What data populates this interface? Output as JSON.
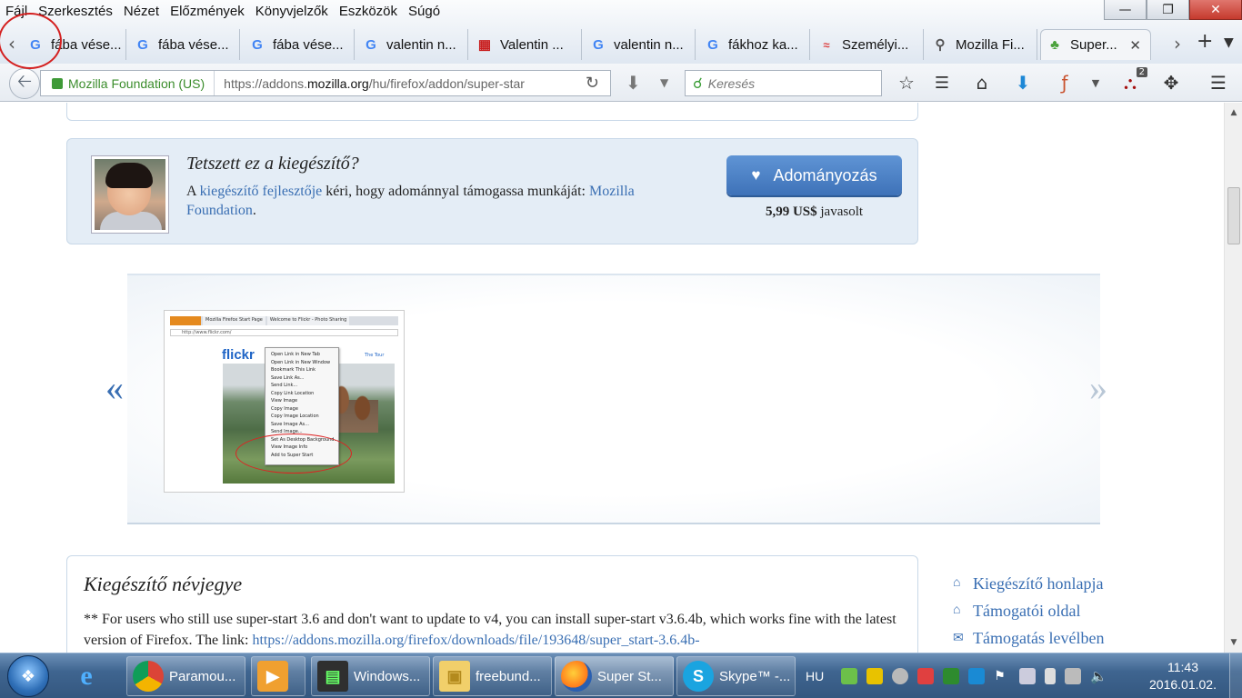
{
  "menubar": [
    "Fájl",
    "Szerkesztés",
    "Nézet",
    "Előzmények",
    "Könyvjelzők",
    "Eszközök",
    "Súgó"
  ],
  "tabs": [
    {
      "label": "fába vése...",
      "icon": "google-icon"
    },
    {
      "label": "fába vése...",
      "icon": "google-icon"
    },
    {
      "label": "fába vése...",
      "icon": "google-icon"
    },
    {
      "label": "valentin n...",
      "icon": "google-icon"
    },
    {
      "label": "Valentin ...",
      "icon": "gift-icon"
    },
    {
      "label": "valentin n...",
      "icon": "google-icon"
    },
    {
      "label": "fákhoz ka...",
      "icon": "google-icon"
    },
    {
      "label": "Személyi...",
      "icon": "chart-icon"
    },
    {
      "label": "Mozilla Fi...",
      "icon": "mozilla-icon"
    },
    {
      "label": "Super...",
      "icon": "puzzle-icon",
      "active": true
    }
  ],
  "nav": {
    "identity": "Mozilla Foundation (US)",
    "url_prefix": "https://addons.",
    "url_domain": "mozilla.org",
    "url_suffix": "/hu/firefox/addon/super-star",
    "search_placeholder": "Keresés",
    "badge_count": "2"
  },
  "donate": {
    "question": "Tetszett ez a kiegészítő?",
    "text_a": "A ",
    "dev_link": "kiegészítő fejlesztője",
    "text_b": " kéri, hogy adománnyal támogassa munkáját: ",
    "org_link": "Mozilla Foundation",
    "text_c": ".",
    "button": "Adományozás",
    "amount": "5,99 US$",
    "suggested": "javasolt"
  },
  "gallery": {
    "prev": "«",
    "next": "»",
    "thumb": {
      "tab1": "Mozilla Firefox Start Page",
      "tab2": "Welcome to Flickr - Photo Sharing",
      "url": "http://www.flickr.com/",
      "logo": "flickr",
      "tour": "The Tour",
      "menu": [
        "Open Link in New Tab",
        "Open Link in New Window",
        "Bookmark This Link",
        "Save Link As...",
        "Send Link...",
        "Copy Link Location",
        "View Image",
        "Copy Image",
        "Copy Image Location",
        "Save Image As...",
        "Send Image...",
        "Set As Desktop Background...",
        "View Image Info",
        "Add to Super Start"
      ]
    }
  },
  "about": {
    "title": "Kiegészítő névjegye",
    "text": "** For users who still use super-start 3.6 and don't want to update to v4, you can install super-start v3.6.4b, which works fine with the latest version of Firefox. The link: ",
    "link": "https://addons.mozilla.org/firefox/downloads/file/193648/super_start-3.6.4b-"
  },
  "sidelinks": [
    "Kiegészítő honlapja",
    "Támogatói oldal",
    "Támogatás levélben"
  ],
  "taskbar": {
    "tasks": [
      {
        "label": "Paramou...",
        "icon": "chrome-icon"
      },
      {
        "label": "Windows...",
        "icon": "terminal-icon"
      },
      {
        "label": "freebund...",
        "icon": "folder-icon"
      },
      {
        "label": "Super St...",
        "icon": "firefox-icon",
        "active": true
      },
      {
        "label": "Skype™ -...",
        "icon": "skype-icon"
      }
    ],
    "lang": "HU",
    "time": "11:43",
    "date": "2016.01.02."
  },
  "colors": {
    "link": "#3a6fb3",
    "donate_button": "#4a7fc4",
    "annotation": "#d42020"
  }
}
